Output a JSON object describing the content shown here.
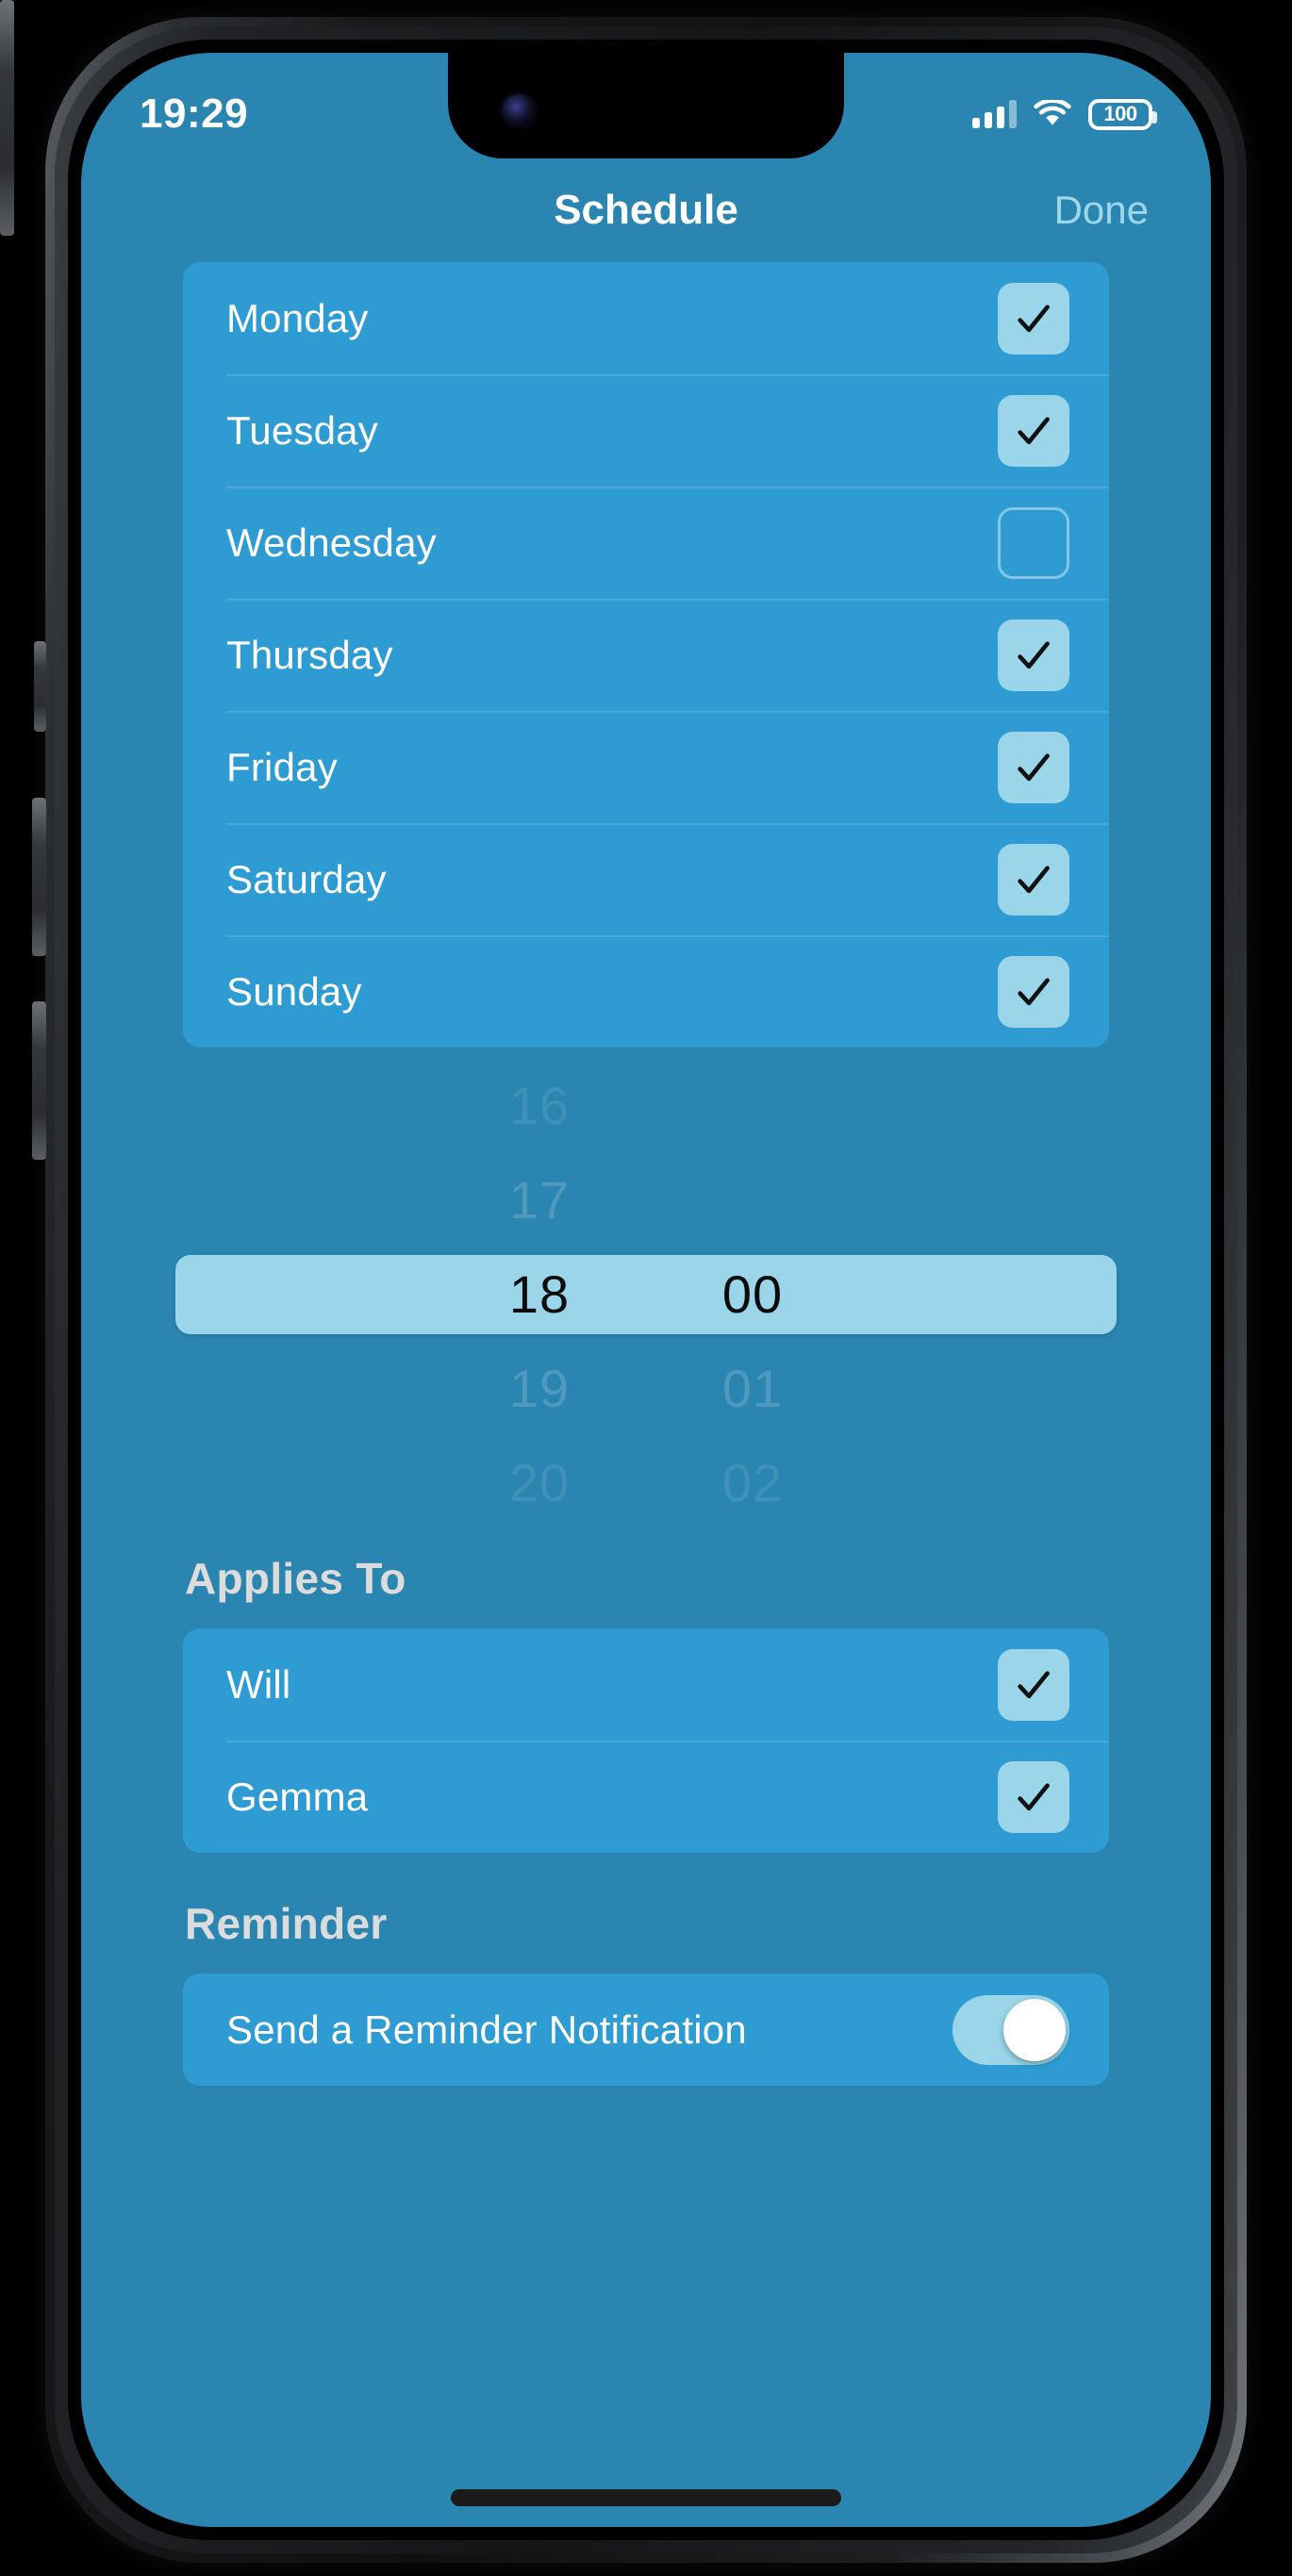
{
  "status_bar": {
    "time": "19:29",
    "battery_level": "100",
    "signal_icon": "cellular-bars-icon",
    "wifi_icon": "wifi-icon",
    "battery_icon": "battery-icon"
  },
  "nav": {
    "title": "Schedule",
    "done_label": "Done"
  },
  "days": [
    {
      "label": "Monday",
      "checked": true
    },
    {
      "label": "Tuesday",
      "checked": true
    },
    {
      "label": "Wednesday",
      "checked": false
    },
    {
      "label": "Thursday",
      "checked": true
    },
    {
      "label": "Friday",
      "checked": true
    },
    {
      "label": "Saturday",
      "checked": true
    },
    {
      "label": "Sunday",
      "checked": true
    }
  ],
  "time_picker": {
    "selected_hour": "18",
    "selected_minute": "00",
    "hours_visible": [
      "16",
      "17",
      "18",
      "19",
      "20"
    ],
    "minutes_visible": [
      "",
      "",
      "00",
      "01",
      "02"
    ]
  },
  "applies_to": {
    "header": "Applies To",
    "people": [
      {
        "label": "Will",
        "checked": true
      },
      {
        "label": "Gemma",
        "checked": true
      }
    ]
  },
  "reminder": {
    "header": "Reminder",
    "row_label": "Send a Reminder Notification",
    "toggle_on": true
  },
  "colors": {
    "page_background": "#2a85b0",
    "card_background": "#2e9bd2",
    "accent_light": "#9ad5e9",
    "done_text": "#9ed6ea",
    "section_header_text": "#dcdcdc"
  }
}
